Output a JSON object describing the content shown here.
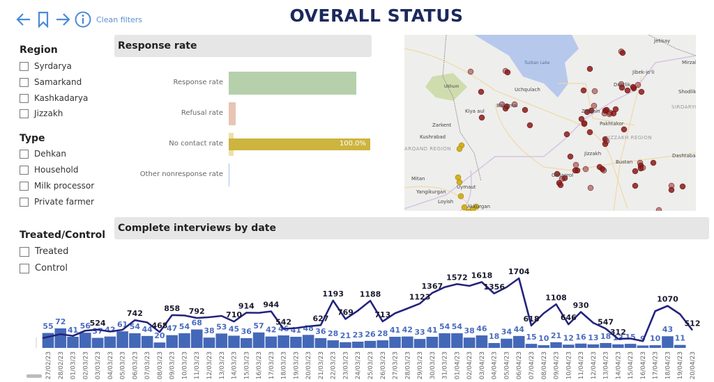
{
  "toolbar": {
    "icons": [
      "back-arrow-icon",
      "bookmark-icon",
      "forward-arrow-icon",
      "info-icon"
    ],
    "clean_filters": "Clean filters",
    "accent": "#4a8ad8"
  },
  "title": "OVERALL STATUS",
  "filters": {
    "region": {
      "heading": "Region",
      "items": [
        "Syrdarya",
        "Samarkand",
        "Kashkadarya",
        "Jizzakh"
      ]
    },
    "type": {
      "heading": "Type",
      "items": [
        "Dehkan",
        "Household",
        "Milk processor",
        "Private farmer"
      ]
    },
    "treated": {
      "heading": "Treated/Control",
      "items": [
        "Treated",
        "Control"
      ]
    }
  },
  "response_panel": {
    "title": "Response rate",
    "bars": [
      {
        "label": "Response rate",
        "value": 90,
        "color": "#b5d0ab"
      },
      {
        "label": "Refusal rate",
        "value": 5,
        "color": "#e8c4b4"
      },
      {
        "label": "No contact rate",
        "value": 100,
        "value_label": "100.0%",
        "color": "#cdb43e",
        "bg_color": "#ece0a8"
      },
      {
        "label": "Other nonresponse rate",
        "value": 0,
        "color": "#a8c4ec"
      }
    ]
  },
  "map": {
    "places": [
      "Jetisay",
      "Mirzak",
      "Tuzkan Lake",
      "Jibek-jo'li",
      "Ukhum",
      "Uchqulach",
      "Dustlik",
      "Shodlik",
      "SIRDARYO",
      "Bakhmal",
      "Zaamin",
      "Kiya aul",
      "Zarkent",
      "Kushrabad",
      "ARQAND REGION",
      "Pakhtakor",
      "JIZZAKH REGION",
      "Jizzakh",
      "Bustan",
      "Dashtabad",
      "Gallaorol",
      "Mitan",
      "Uymaut",
      "Yangikurgan",
      "Loyish",
      "Akkurgan"
    ],
    "dot_colors": {
      "jizzakh": "#8b1a1a",
      "samarkand": "#d4b020"
    }
  },
  "interviews_panel": {
    "title": "Complete interviews by date",
    "chart_data": {
      "type": "bar+line",
      "categories": [
        "27/02/23",
        "28/02/23",
        "01/03/23",
        "02/03/23",
        "03/03/23",
        "04/03/23",
        "05/03/23",
        "06/03/23",
        "07/03/23",
        "08/03/23",
        "09/03/23",
        "10/03/23",
        "11/03/23",
        "12/03/23",
        "13/03/23",
        "14/03/23",
        "15/03/23",
        "16/03/23",
        "17/03/23",
        "18/03/23",
        "19/03/23",
        "20/03/23",
        "21/03/23",
        "22/03/23",
        "23/03/23",
        "24/03/23",
        "25/03/23",
        "26/03/23",
        "27/03/23",
        "28/03/23",
        "29/03/23",
        "30/03/23",
        "31/03/23",
        "01/04/23",
        "02/04/23",
        "03/04/23",
        "04/04/23",
        "05/04/23",
        "06/04/23",
        "07/04/23",
        "08/04/23",
        "09/04/23",
        "10/04/23",
        "11/04/23",
        "12/04/23",
        "13/04/23",
        "14/04/23",
        "15/04/23",
        "16/04/23",
        "17/04/23",
        "18/04/23",
        "19/04/23",
        "20/04/23"
      ],
      "series": [
        {
          "type": "bar",
          "color": "#4468b8",
          "values": [
            55,
            72,
            41,
            56,
            37,
            42,
            61,
            54,
            44,
            20,
            47,
            54,
            68,
            38,
            53,
            45,
            36,
            57,
            42,
            46,
            41,
            48,
            36,
            28,
            21,
            23,
            26,
            28,
            41,
            42,
            33,
            41,
            54,
            54,
            38,
            46,
            18,
            34,
            44,
            15,
            10,
            21,
            12,
            16,
            13,
            18,
            13,
            15,
            9,
            10,
            43,
            11,
            null
          ]
        },
        {
          "type": "line",
          "color": "#23237e",
          "values": [
            330,
            420,
            380,
            500,
            524,
            480,
            520,
            742,
            690,
            468,
            858,
            850,
            792,
            810,
            840,
            710,
            914,
            910,
            944,
            542,
            560,
            600,
            627,
            1193,
            769,
            960,
            1188,
            713,
            900,
            1010,
            1123,
            1367,
            1500,
            1572,
            1530,
            1618,
            1356,
            1500,
            1704,
            618,
            900,
            1108,
            646,
            930,
            680,
            547,
            312,
            320,
            260,
            950,
            1070,
            880,
            512
          ],
          "labels": [
            null,
            null,
            null,
            null,
            "524",
            null,
            null,
            "742",
            null,
            "468",
            "858",
            null,
            "792",
            null,
            null,
            "710",
            "914",
            null,
            "944",
            "542",
            null,
            null,
            "627",
            "1193",
            "769",
            null,
            "1188",
            "713",
            null,
            null,
            "1123",
            "1367",
            null,
            "1572",
            null,
            "1618",
            "1356",
            null,
            "1704",
            "618",
            null,
            "1108",
            "646",
            "930",
            null,
            "547",
            "312",
            null,
            null,
            null,
            "1070",
            null,
            "512"
          ]
        }
      ]
    }
  }
}
